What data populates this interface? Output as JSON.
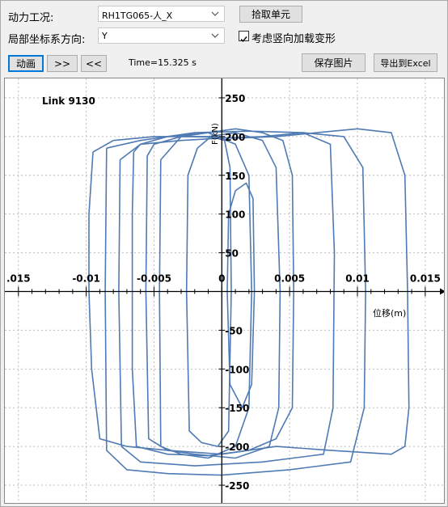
{
  "controls": {
    "load_case_label": "动力工况:",
    "load_case_value": "RH1TG065-人_X",
    "pick_element_label": "拾取单元",
    "direction_label": "局部坐标系方向:",
    "direction_value": "Y",
    "vertical_load_label": "考虑竖向加载变形",
    "vertical_load_checked": true
  },
  "toolbar": {
    "animate_label": "动画",
    "forward_label": ">>",
    "back_label": "<<",
    "time_text": "Time=15.325 s",
    "save_image_label": "保存图片",
    "export_excel_label": "导出到Excel"
  },
  "chart_data": {
    "type": "line",
    "title": "Link 9130",
    "xlabel": "位移(m)",
    "ylabel": "F(kN)",
    "xlim": [
      -0.016,
      0.0165
    ],
    "ylim": [
      -275,
      275
    ],
    "xticks": [
      -0.015,
      -0.01,
      -0.005,
      0,
      0.005,
      0.01,
      0.015
    ],
    "xtick_labels": [
      ".015",
      "-0.01",
      "-0.005",
      "0",
      "0.005",
      "0.01",
      "0.015"
    ],
    "yticks": [
      250,
      200,
      150,
      100,
      50,
      -50,
      -100,
      -150,
      -200,
      -250
    ],
    "ytick_labels": [
      "250",
      "200",
      "150",
      "100",
      "50",
      "-50",
      "-100",
      "-150",
      "-200",
      "-250"
    ],
    "grid": true,
    "line_color": "#4f7ab3",
    "series": [
      {
        "x": [
          -0.0095,
          -0.0098,
          -0.0098,
          -0.0096,
          -0.009,
          -0.007,
          -0.004,
          0,
          0.004,
          0.008,
          0.0125,
          0.0135,
          0.0138,
          0.0137,
          0.0135,
          0.0125,
          0.01,
          0.007,
          0.004,
          0.001,
          -0.002,
          -0.005,
          -0.008,
          -0.0095
        ],
        "y": [
          180,
          100,
          0,
          -100,
          -190,
          -200,
          -205,
          -210,
          -200,
          -205,
          -210,
          -200,
          -150,
          0,
          150,
          205,
          210,
          205,
          200,
          198,
          200,
          200,
          195,
          180
        ]
      },
      {
        "x": [
          -0.0065,
          -0.0066,
          -0.0066,
          -0.0063,
          -0.004,
          -0.001,
          0.002,
          0.004,
          0.0052,
          0.0053,
          0.0052,
          0.0045,
          0.003,
          0.001,
          -0.001,
          -0.004,
          -0.006,
          -0.0065
        ],
        "y": [
          180,
          100,
          -100,
          -200,
          -210,
          -212,
          -205,
          -190,
          -150,
          0,
          150,
          195,
          205,
          210,
          205,
          200,
          190,
          180
        ]
      },
      {
        "x": [
          -0.0075,
          -0.0076,
          -0.0074,
          -0.006,
          -0.002,
          0.003,
          0.0075,
          0.0082,
          0.0083,
          0.008,
          0.006,
          0.003,
          0,
          -0.003,
          -0.006,
          -0.0075
        ],
        "y": [
          170,
          0,
          -200,
          -220,
          -225,
          -220,
          -210,
          -150,
          50,
          190,
          205,
          200,
          198,
          195,
          190,
          170
        ]
      },
      {
        "x": [
          -0.0045,
          -0.0046,
          -0.0045,
          -0.003,
          -0.001,
          0.001,
          0.002,
          0.0022,
          0.002,
          0.001,
          -0.001,
          -0.003,
          -0.0045
        ],
        "y": [
          170,
          0,
          -200,
          -210,
          -215,
          -200,
          -150,
          0,
          150,
          190,
          205,
          200,
          170
        ]
      },
      {
        "x": [
          -0.0025,
          -0.0026,
          -0.0024,
          -0.0015,
          -0.0003,
          0.0005,
          0.0007,
          0.0006,
          0.0002,
          -0.0008,
          -0.0018,
          -0.0025
        ],
        "y": [
          150,
          0,
          -180,
          -195,
          -200,
          -180,
          0,
          160,
          195,
          200,
          185,
          150
        ]
      },
      {
        "x": [
          -0.0055,
          -0.0056,
          -0.0054,
          -0.004,
          -0.002,
          0.001,
          0.0035,
          0.0042,
          0.0043,
          0.004,
          0.003,
          0.001,
          -0.001,
          -0.003,
          -0.005,
          -0.0055
        ],
        "y": [
          175,
          0,
          -190,
          -205,
          -210,
          -215,
          -200,
          -150,
          0,
          160,
          195,
          205,
          200,
          200,
          190,
          175
        ]
      },
      {
        "x": [
          0.0005,
          0.0004,
          0.0006,
          0.0015,
          0.0022,
          0.0024,
          0.0023,
          0.0018,
          0.001,
          0.0005
        ],
        "y": [
          100,
          0,
          -120,
          -150,
          -120,
          0,
          120,
          140,
          130,
          100
        ]
      },
      {
        "x": [
          -0.0085,
          -0.0086,
          -0.0085,
          -0.007,
          -0.004,
          0,
          0.005,
          0.0095,
          0.0105,
          0.0106,
          0.0104,
          0.009,
          0.006,
          0.002,
          -0.002,
          -0.006,
          -0.0085
        ],
        "y": [
          185,
          0,
          -205,
          -230,
          -235,
          -237,
          -230,
          -220,
          -150,
          0,
          160,
          200,
          205,
          207,
          205,
          195,
          185
        ]
      }
    ]
  }
}
